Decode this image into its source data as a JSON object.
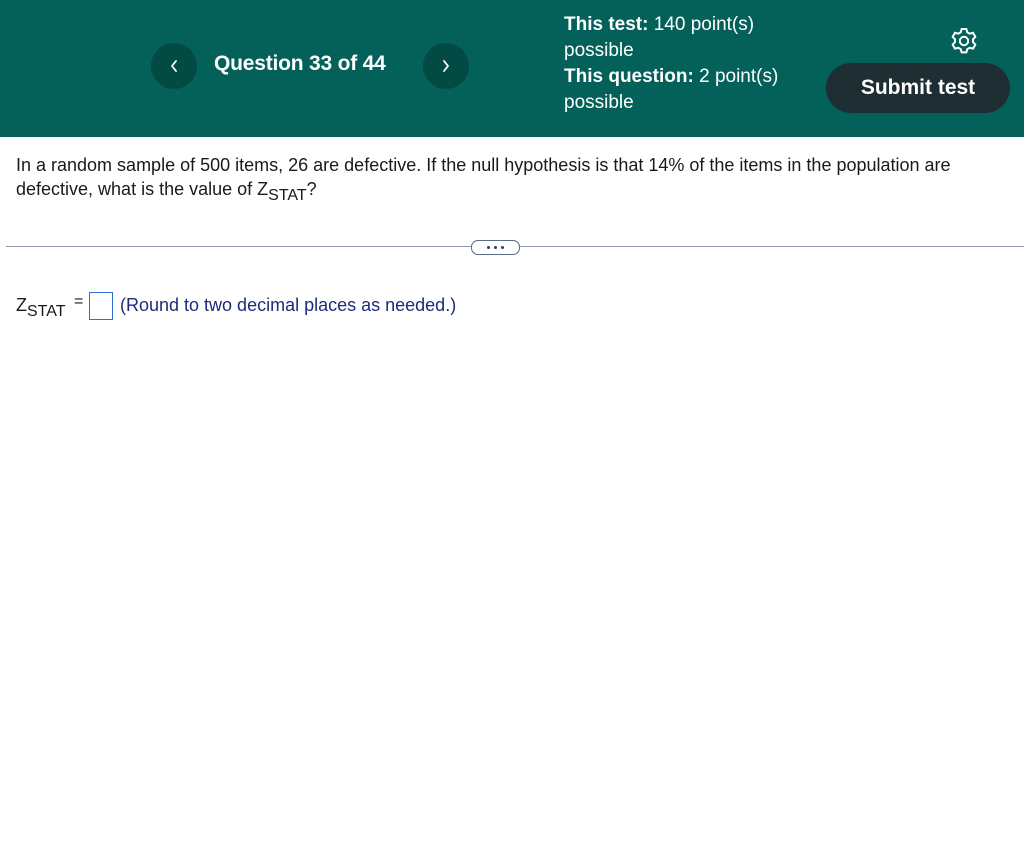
{
  "header": {
    "question_label": "Question 33 of 44",
    "test_points_label": "This test:",
    "test_points_value": "140 point(s) possible",
    "question_points_label": "This question:",
    "question_points_value": "2 point(s) possible",
    "submit_label": "Submit test",
    "icons": {
      "prev": "chevron-left-icon",
      "next": "chevron-right-icon",
      "settings": "gear-icon"
    },
    "colors": {
      "background": "#036159",
      "nav_button": "#024b44",
      "submit_button": "#1e2e33"
    }
  },
  "question": {
    "text": "In a random sample of 500 items, 26 are defective. If the null hypothesis is that 14% of the items in the population are defective, what is the value of Z",
    "subscript": "STAT",
    "end": "?"
  },
  "answer": {
    "var": "Z",
    "var_sub": "STAT",
    "equals": "=",
    "value": "",
    "hint": "(Round to two decimal places as needed.)"
  }
}
